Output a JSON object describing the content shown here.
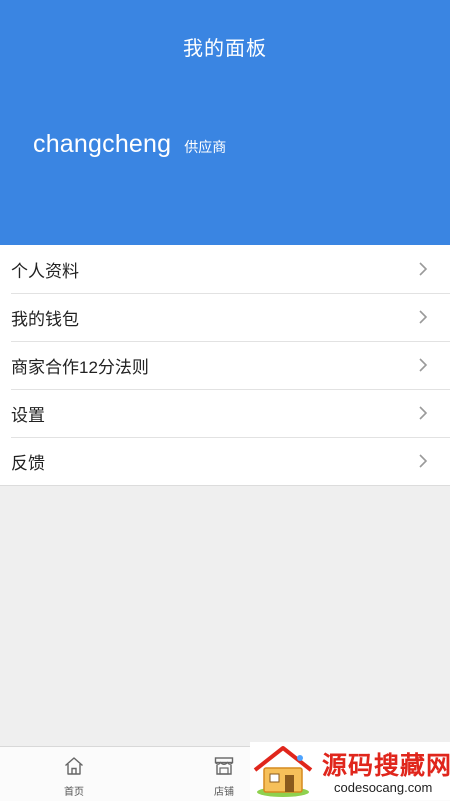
{
  "header": {
    "title": "我的面板",
    "username": "changcheng",
    "role": "供应商",
    "bg_color": "#3a85e2"
  },
  "menu": {
    "items": [
      {
        "label": "个人资料",
        "icon": "chevron-right-icon"
      },
      {
        "label": "我的钱包",
        "icon": "chevron-right-icon"
      },
      {
        "label": "商家合作12分法则",
        "icon": "chevron-right-icon"
      },
      {
        "label": "设置",
        "icon": "chevron-right-icon"
      },
      {
        "label": "反馈",
        "icon": "chevron-right-icon"
      }
    ]
  },
  "tabbar": {
    "tabs": [
      {
        "label": "首页",
        "icon": "home-icon"
      },
      {
        "label": "店铺",
        "icon": "store-icon"
      }
    ]
  },
  "watermark": {
    "title": "源码搜藏网",
    "url": "codesocang.com"
  }
}
